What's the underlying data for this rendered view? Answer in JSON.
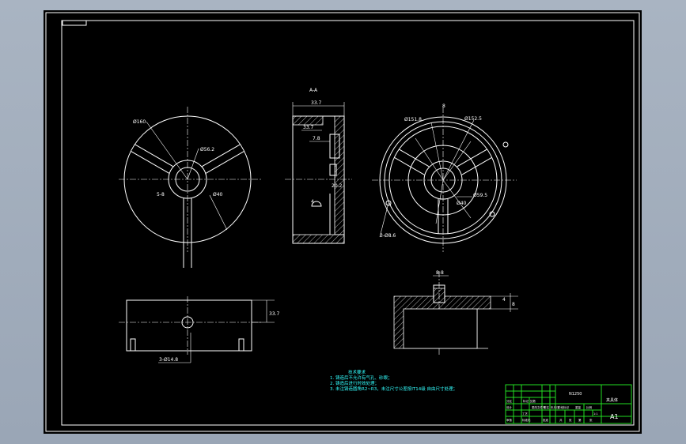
{
  "views": {
    "top_left": {
      "dim_outer": "Ø160",
      "dim_inner": "Ø56.2",
      "dim_bore": "Ø40",
      "dim_slot": "5-8"
    },
    "section_aa": {
      "label": "A-A",
      "dim_width": "33.7",
      "dim_a": "33.7",
      "dim_b": "7.8",
      "dim_c": "20.2",
      "dim_d": "4"
    },
    "top_right": {
      "dim_d1": "Ø151.8",
      "dim_d2": "Ø152.5",
      "dim_d3": "Ø59.5",
      "dim_d4": "Ø40",
      "dim_d5": "3-Ø8.6",
      "dim_b": "8"
    },
    "front": {
      "dim_height": "33.7",
      "dim_holes": "3-Ø14.8"
    },
    "section_bb": {
      "dim_top": "8-8",
      "dim_r1": "4",
      "dim_r2": "8"
    }
  },
  "notes": {
    "title": "技术要求",
    "lines": [
      "1. 铸造后不允许有气孔、砂眼；",
      "2. 铸造后进行时效处理；",
      "3. 未注铸造圆角R2~R3，未注尺寸公差按IT14级 自由尺寸处理；"
    ]
  },
  "title_block": {
    "part_no": "N1250",
    "name": "夹具体",
    "sheet_size": "A1",
    "header_labels": [
      "标记",
      "处数",
      "分区",
      "更改文件号",
      "签名",
      "年月日"
    ],
    "row_labels": [
      "设计",
      "审核",
      "工艺",
      "标准化",
      "批准"
    ],
    "stage_labels": [
      "阶段标记",
      "重量",
      "比例"
    ],
    "footer_labels": [
      "共",
      "张",
      "第",
      "张"
    ],
    "scale": "1:1"
  }
}
